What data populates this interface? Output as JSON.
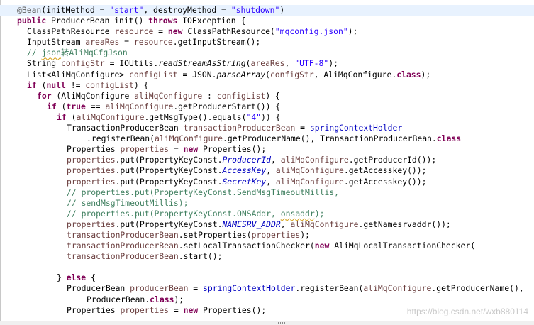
{
  "editor": {
    "colors": {
      "keyword": "#7f0055",
      "string": "#2a00ff",
      "comment": "#3f7f5f",
      "annotation": "#646464",
      "field": "#0000c0",
      "local_variable": "#6a3e3e",
      "current_line_highlight": "#e8f2fe"
    },
    "lines": [
      {
        "indent": 1,
        "current": true,
        "tokens": [
          {
            "t": "@Bean",
            "k": "ann"
          },
          {
            "t": "(initMethod = ",
            "k": "plain"
          },
          {
            "t": "\"start\"",
            "k": "str"
          },
          {
            "t": ", destroyMethod = ",
            "k": "plain"
          },
          {
            "t": "\"shutdown\"",
            "k": "str"
          },
          {
            "t": ")",
            "k": "plain"
          }
        ]
      },
      {
        "indent": 1,
        "tokens": [
          {
            "t": "public",
            "k": "kw"
          },
          {
            "t": " ProducerBean init() ",
            "k": "plain"
          },
          {
            "t": "throws",
            "k": "kw"
          },
          {
            "t": " IOException {",
            "k": "plain"
          }
        ]
      },
      {
        "indent": 3,
        "tokens": [
          {
            "t": "ClassPathResource ",
            "k": "plain"
          },
          {
            "t": "resource",
            "k": "local"
          },
          {
            "t": " = ",
            "k": "plain"
          },
          {
            "t": "new",
            "k": "kw"
          },
          {
            "t": " ClassPathResource(",
            "k": "plain"
          },
          {
            "t": "\"mqconfig.json\"",
            "k": "str"
          },
          {
            "t": ");",
            "k": "plain"
          }
        ]
      },
      {
        "indent": 3,
        "tokens": [
          {
            "t": "InputStream ",
            "k": "plain"
          },
          {
            "t": "areaRes",
            "k": "local"
          },
          {
            "t": " = ",
            "k": "plain"
          },
          {
            "t": "resource",
            "k": "local"
          },
          {
            "t": ".getInputStream();",
            "k": "plain"
          }
        ]
      },
      {
        "indent": 3,
        "tokens": [
          {
            "t": "// ",
            "k": "cm"
          },
          {
            "t": "json",
            "k": "cm",
            "squig": true
          },
          {
            "t": "转AliMqCfgJson",
            "k": "cm"
          }
        ]
      },
      {
        "indent": 3,
        "tokens": [
          {
            "t": "String ",
            "k": "plain"
          },
          {
            "t": "configStr",
            "k": "local"
          },
          {
            "t": " = IOUtils.",
            "k": "plain"
          },
          {
            "t": "readStreamAsString",
            "k": "ital"
          },
          {
            "t": "(",
            "k": "plain"
          },
          {
            "t": "areaRes",
            "k": "local"
          },
          {
            "t": ", ",
            "k": "plain"
          },
          {
            "t": "\"UTF-8\"",
            "k": "str"
          },
          {
            "t": ");",
            "k": "plain"
          }
        ]
      },
      {
        "indent": 3,
        "tokens": [
          {
            "t": "List<AliMqConfigure> ",
            "k": "plain"
          },
          {
            "t": "configList",
            "k": "local"
          },
          {
            "t": " = JSON.",
            "k": "plain"
          },
          {
            "t": "parseArray",
            "k": "ital"
          },
          {
            "t": "(",
            "k": "plain"
          },
          {
            "t": "configStr",
            "k": "local"
          },
          {
            "t": ", AliMqConfigure.",
            "k": "plain"
          },
          {
            "t": "class",
            "k": "kw"
          },
          {
            "t": ");",
            "k": "plain"
          }
        ]
      },
      {
        "indent": 3,
        "tokens": [
          {
            "t": "if",
            "k": "kw"
          },
          {
            "t": " (",
            "k": "plain"
          },
          {
            "t": "null",
            "k": "kw"
          },
          {
            "t": " != ",
            "k": "plain"
          },
          {
            "t": "configList",
            "k": "local"
          },
          {
            "t": ") {",
            "k": "plain"
          }
        ]
      },
      {
        "indent": 5,
        "tokens": [
          {
            "t": "for",
            "k": "kw"
          },
          {
            "t": " (AliMqConfigure ",
            "k": "plain"
          },
          {
            "t": "aliMqConfigure",
            "k": "local"
          },
          {
            "t": " : ",
            "k": "plain"
          },
          {
            "t": "configList",
            "k": "local"
          },
          {
            "t": ") {",
            "k": "plain"
          }
        ]
      },
      {
        "indent": 7,
        "tokens": [
          {
            "t": "if",
            "k": "kw"
          },
          {
            "t": " (",
            "k": "plain"
          },
          {
            "t": "true",
            "k": "kw"
          },
          {
            "t": " == ",
            "k": "plain"
          },
          {
            "t": "aliMqConfigure",
            "k": "local"
          },
          {
            "t": ".getProducerStart()) {",
            "k": "plain"
          }
        ]
      },
      {
        "indent": 9,
        "tokens": [
          {
            "t": "if",
            "k": "kw"
          },
          {
            "t": " (",
            "k": "plain"
          },
          {
            "t": "aliMqConfigure",
            "k": "local"
          },
          {
            "t": ".getMsgType().equals(",
            "k": "plain"
          },
          {
            "t": "\"4\"",
            "k": "str"
          },
          {
            "t": ")) {",
            "k": "plain"
          }
        ]
      },
      {
        "indent": 11,
        "tokens": [
          {
            "t": "TransactionProducerBean ",
            "k": "plain"
          },
          {
            "t": "transactionProducerBean",
            "k": "local"
          },
          {
            "t": " = ",
            "k": "plain"
          },
          {
            "t": "springContextHolder",
            "k": "field"
          }
        ]
      },
      {
        "indent": 15,
        "tokens": [
          {
            "t": ".registerBean(",
            "k": "plain"
          },
          {
            "t": "aliMqConfigure",
            "k": "local"
          },
          {
            "t": ".getProducerName(), TransactionProducerBean.",
            "k": "plain"
          },
          {
            "t": "class",
            "k": "kw"
          }
        ]
      },
      {
        "indent": 11,
        "tokens": [
          {
            "t": "Properties ",
            "k": "plain"
          },
          {
            "t": "properties",
            "k": "local"
          },
          {
            "t": " = ",
            "k": "plain"
          },
          {
            "t": "new",
            "k": "kw"
          },
          {
            "t": " Properties();",
            "k": "plain"
          }
        ]
      },
      {
        "indent": 11,
        "tokens": [
          {
            "t": "properties",
            "k": "local"
          },
          {
            "t": ".put(PropertyKeyConst.",
            "k": "plain"
          },
          {
            "t": "ProducerId",
            "k": "sfield"
          },
          {
            "t": ", ",
            "k": "plain"
          },
          {
            "t": "aliMqConfigure",
            "k": "local"
          },
          {
            "t": ".getProducerId());",
            "k": "plain"
          }
        ]
      },
      {
        "indent": 11,
        "tokens": [
          {
            "t": "properties",
            "k": "local"
          },
          {
            "t": ".put(PropertyKeyConst.",
            "k": "plain"
          },
          {
            "t": "AccessKey",
            "k": "sfield"
          },
          {
            "t": ", ",
            "k": "plain"
          },
          {
            "t": "aliMqConfigure",
            "k": "local"
          },
          {
            "t": ".getAccesskey());",
            "k": "plain"
          }
        ]
      },
      {
        "indent": 11,
        "tokens": [
          {
            "t": "properties",
            "k": "local"
          },
          {
            "t": ".put(PropertyKeyConst.",
            "k": "plain"
          },
          {
            "t": "SecretKey",
            "k": "sfield"
          },
          {
            "t": ", ",
            "k": "plain"
          },
          {
            "t": "aliMqConfigure",
            "k": "local"
          },
          {
            "t": ".getAccesskey());",
            "k": "plain"
          }
        ]
      },
      {
        "indent": 11,
        "tokens": [
          {
            "t": "// properties.put(PropertyKeyConst.SendMsgTimeoutMillis,",
            "k": "cm"
          }
        ]
      },
      {
        "indent": 11,
        "tokens": [
          {
            "t": "// sendMsgTimeoutMillis);",
            "k": "cm"
          }
        ]
      },
      {
        "indent": 11,
        "tokens": [
          {
            "t": "// properties.put(PropertyKeyConst.ONSAddr, ",
            "k": "cm"
          },
          {
            "t": "onsaddr",
            "k": "cm",
            "squig": true
          },
          {
            "t": ");",
            "k": "cm"
          }
        ]
      },
      {
        "indent": 11,
        "tokens": [
          {
            "t": "properties",
            "k": "local"
          },
          {
            "t": ".put(PropertyKeyConst.",
            "k": "plain"
          },
          {
            "t": "NAMESRV_ADDR",
            "k": "sfield"
          },
          {
            "t": ", ",
            "k": "plain"
          },
          {
            "t": "aliMqConfigure",
            "k": "local"
          },
          {
            "t": ".getNamesrvaddr());",
            "k": "plain"
          }
        ]
      },
      {
        "indent": 11,
        "tokens": [
          {
            "t": "transactionProducerBean",
            "k": "local"
          },
          {
            "t": ".setProperties(",
            "k": "plain"
          },
          {
            "t": "properties",
            "k": "local"
          },
          {
            "t": ");",
            "k": "plain"
          }
        ]
      },
      {
        "indent": 11,
        "tokens": [
          {
            "t": "transactionProducerBean",
            "k": "local"
          },
          {
            "t": ".setLocalTransactionChecker(",
            "k": "plain"
          },
          {
            "t": "new",
            "k": "kw"
          },
          {
            "t": " AliMqLocalTransactionChecker(",
            "k": "plain"
          }
        ]
      },
      {
        "indent": 11,
        "tokens": [
          {
            "t": "transactionProducerBean",
            "k": "local"
          },
          {
            "t": ".start();",
            "k": "plain"
          }
        ]
      },
      {
        "indent": 0,
        "tokens": []
      },
      {
        "indent": 9,
        "tokens": [
          {
            "t": "} ",
            "k": "plain"
          },
          {
            "t": "else",
            "k": "kw"
          },
          {
            "t": " {",
            "k": "plain"
          }
        ]
      },
      {
        "indent": 11,
        "tokens": [
          {
            "t": "ProducerBean ",
            "k": "plain"
          },
          {
            "t": "producerBean",
            "k": "local"
          },
          {
            "t": " = ",
            "k": "plain"
          },
          {
            "t": "springContextHolder",
            "k": "field"
          },
          {
            "t": ".registerBean(",
            "k": "plain"
          },
          {
            "t": "aliMqConfigure",
            "k": "local"
          },
          {
            "t": ".getProducerName(), ",
            "k": "plain"
          }
        ]
      },
      {
        "indent": 15,
        "tokens": [
          {
            "t": "ProducerBean.",
            "k": "plain"
          },
          {
            "t": "class",
            "k": "kw"
          },
          {
            "t": ");",
            "k": "plain"
          }
        ]
      },
      {
        "indent": 11,
        "tokens": [
          {
            "t": "Properties ",
            "k": "plain"
          },
          {
            "t": "properties",
            "k": "local"
          },
          {
            "t": " = ",
            "k": "plain"
          },
          {
            "t": "new",
            "k": "kw"
          },
          {
            "t": " Properties();",
            "k": "plain"
          }
        ]
      }
    ]
  },
  "watermark": "https://blog.csdn.net/wxb880114"
}
